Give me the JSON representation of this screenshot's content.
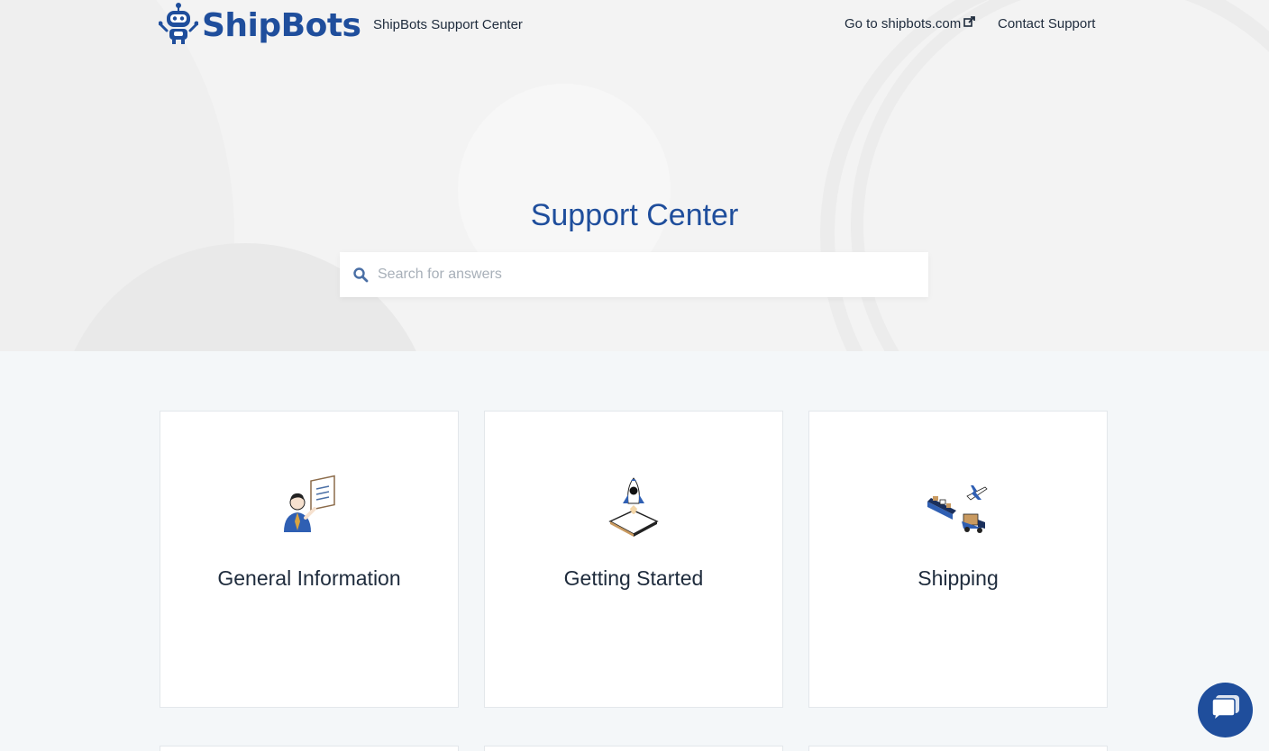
{
  "header": {
    "logo_text": "ShipBots",
    "site_title": "ShipBots Support Center",
    "nav": {
      "external_link": "Go to shipbots.com",
      "contact_link": "Contact Support"
    }
  },
  "hero": {
    "title": "Support Center",
    "search": {
      "placeholder": "Search for answers",
      "value": ""
    }
  },
  "categories": [
    {
      "title": "General Information",
      "icon": "person-checklist-icon"
    },
    {
      "title": "Getting Started",
      "icon": "rocket-launch-icon"
    },
    {
      "title": "Shipping",
      "icon": "shipping-transport-icon"
    }
  ],
  "chat": {
    "icon": "chat-bubble-icon"
  },
  "colors": {
    "brand": "#1f4e9c",
    "text": "#1e2b3c",
    "background": "#f4f7f9",
    "hero": "#f3f3f3"
  }
}
